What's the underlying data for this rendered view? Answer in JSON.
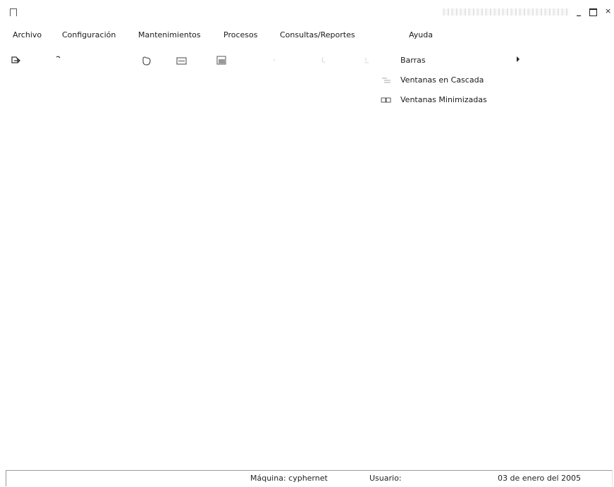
{
  "window": {
    "controls": {
      "minimize": "_",
      "close": "×"
    }
  },
  "menu": {
    "items": [
      "Archivo",
      "Configuración",
      "Mantenimientos",
      "Procesos",
      "Consultas/Reportes",
      "Ayuda"
    ]
  },
  "toolbar": {
    "icons": [
      "print-icon",
      "undo-icon",
      "folder-icon",
      "calculator-icon",
      "monitor-icon",
      "disabled-icon",
      "disabled-icon",
      "disabled-icon"
    ]
  },
  "dropdown": {
    "items": [
      {
        "label": "Barras",
        "icon": "none",
        "submenu": true
      },
      {
        "label": "Ventanas en Cascada",
        "icon": "cascade-icon",
        "submenu": false
      },
      {
        "label": "Ventanas Minimizadas",
        "icon": "minimized-windows-icon",
        "submenu": false
      }
    ]
  },
  "status": {
    "machine": "Máquina: cyphernet",
    "user": "Usuario:",
    "date": "03 de enero del 2005"
  }
}
